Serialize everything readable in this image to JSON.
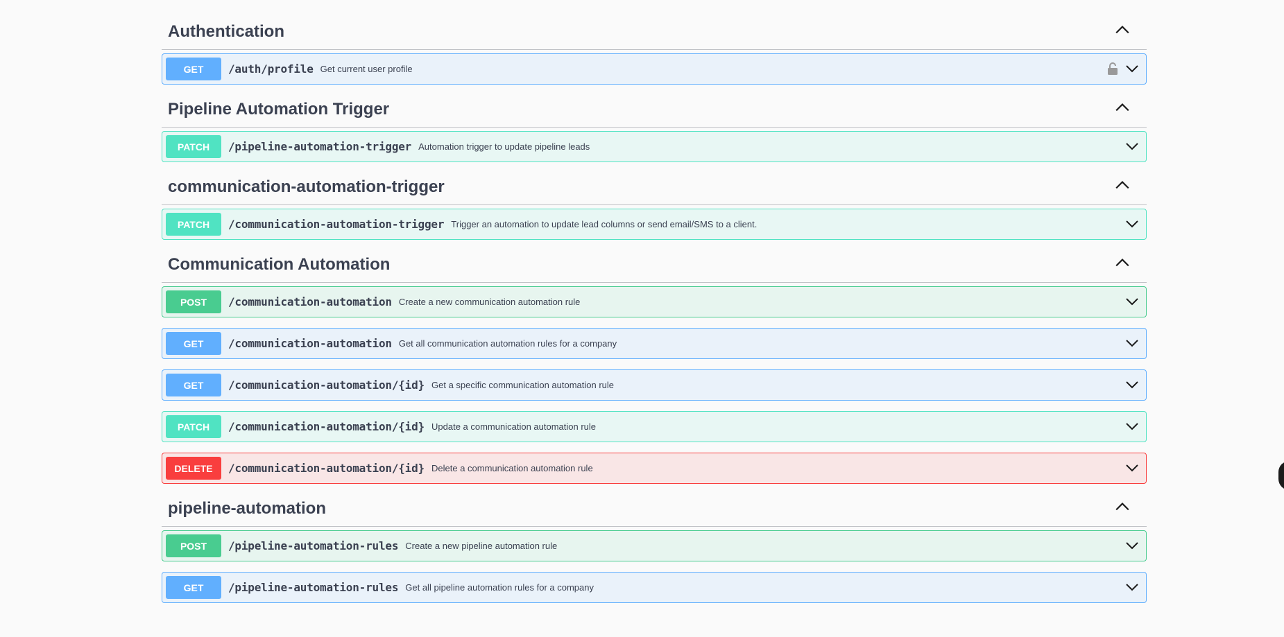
{
  "sections": [
    {
      "title": "Authentication",
      "operations": [
        {
          "method": "GET",
          "path": "/auth/profile",
          "summary": "Get current user profile",
          "locked": true
        }
      ]
    },
    {
      "title": "Pipeline Automation Trigger",
      "operations": [
        {
          "method": "PATCH",
          "path": "/pipeline-automation-trigger",
          "summary": "Automation trigger to update pipeline leads"
        }
      ]
    },
    {
      "title": "communication-automation-trigger",
      "operations": [
        {
          "method": "PATCH",
          "path": "/communication-automation-trigger",
          "summary": "Trigger an automation to update lead columns or send email/SMS to a client."
        }
      ]
    },
    {
      "title": "Communication Automation",
      "operations": [
        {
          "method": "POST",
          "path": "/communication-automation",
          "summary": "Create a new communication automation rule"
        },
        {
          "method": "GET",
          "path": "/communication-automation",
          "summary": "Get all communication automation rules for a company"
        },
        {
          "method": "GET",
          "path": "/communication-automation/{id}",
          "summary": "Get a specific communication automation rule"
        },
        {
          "method": "PATCH",
          "path": "/communication-automation/{id}",
          "summary": "Update a communication automation rule"
        },
        {
          "method": "DELETE",
          "path": "/communication-automation/{id}",
          "summary": "Delete a communication automation rule"
        }
      ]
    },
    {
      "title": "pipeline-automation",
      "operations": [
        {
          "method": "POST",
          "path": "/pipeline-automation-rules",
          "summary": "Create a new pipeline automation rule"
        },
        {
          "method": "GET",
          "path": "/pipeline-automation-rules",
          "summary": "Get all pipeline automation rules for a company"
        }
      ]
    }
  ],
  "icons": {
    "section_toggle": "chevron-up-icon",
    "operation_toggle": "chevron-down-icon",
    "lock": "lock-icon"
  },
  "colors": {
    "get": "#61affe",
    "patch": "#50e3c2",
    "post": "#49cc90",
    "delete": "#f93e3e"
  }
}
